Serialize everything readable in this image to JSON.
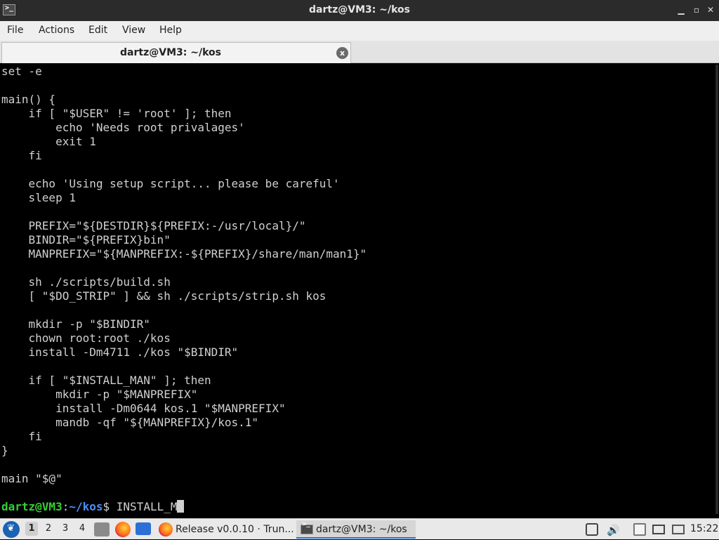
{
  "window": {
    "title": "dartz@VM3: ~/kos",
    "controls": {
      "minimize": "▁",
      "maximize": "▫",
      "close": "✕"
    }
  },
  "menu": {
    "items": [
      "File",
      "Actions",
      "Edit",
      "View",
      "Help"
    ]
  },
  "tab": {
    "label": "dartz@VM3: ~/kos",
    "close_icon": "x"
  },
  "terminal": {
    "lines": [
      "set -e",
      "",
      "main() {",
      "    if [ \"$USER\" != 'root' ]; then",
      "        echo 'Needs root privalages'",
      "        exit 1",
      "    fi",
      "",
      "    echo 'Using setup script... please be careful'",
      "    sleep 1",
      "",
      "    PREFIX=\"${DESTDIR}${PREFIX:-/usr/local}/\"",
      "    BINDIR=\"${PREFIX}bin\"",
      "    MANPREFIX=\"${MANPREFIX:-${PREFIX}/share/man/man1}\"",
      "",
      "    sh ./scripts/build.sh",
      "    [ \"$DO_STRIP\" ] && sh ./scripts/strip.sh kos",
      "",
      "    mkdir -p \"$BINDIR\"",
      "    chown root:root ./kos",
      "    install -Dm4711 ./kos \"$BINDIR\"",
      "",
      "    if [ \"$INSTALL_MAN\" ]; then",
      "        mkdir -p \"$MANPREFIX\"",
      "        install -Dm0644 kos.1 \"$MANPREFIX\"",
      "        mandb -qf \"${MANPREFIX}/kos.1\"",
      "    fi",
      "}",
      "",
      "main \"$@\"",
      ""
    ],
    "prompt": {
      "user_host": "dartz@VM3",
      "separator": ":",
      "path": "~/kos",
      "symbol": "$",
      "input": " INSTALL_M"
    }
  },
  "taskbar": {
    "workspaces": [
      "1",
      "2",
      "3",
      "4"
    ],
    "active_workspace": "1",
    "tasks": [
      {
        "label": "Release v0.0.10 · Trun...",
        "icon": "firefox-icon"
      },
      {
        "label": "dartz@VM3: ~/kos",
        "icon": "terminal-icon"
      }
    ],
    "clock": "15:22"
  }
}
